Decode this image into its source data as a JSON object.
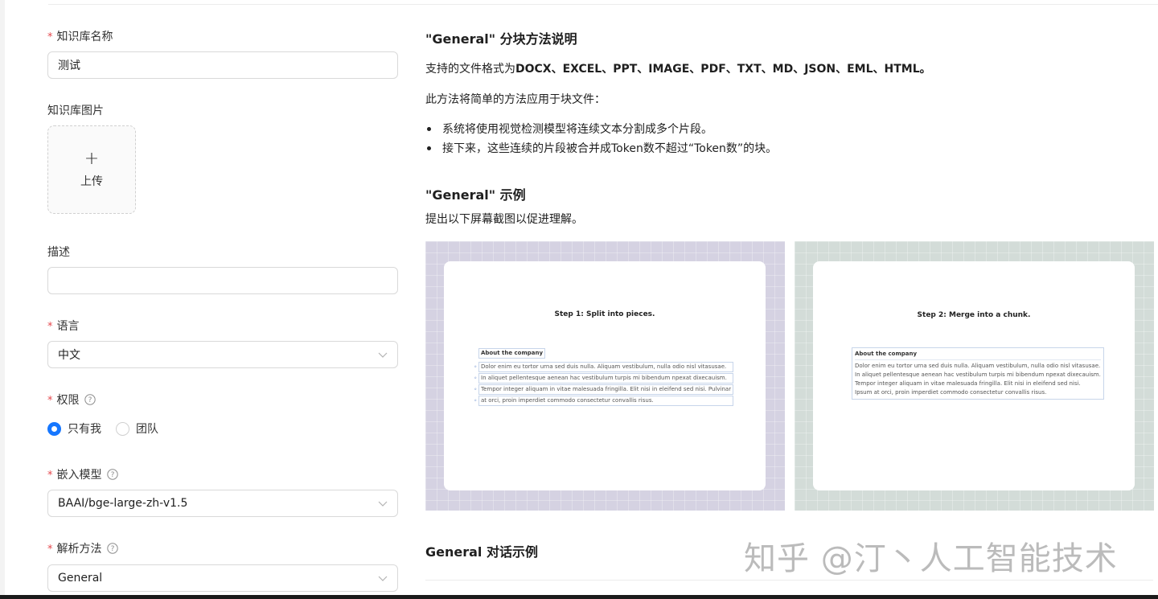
{
  "form": {
    "kb_name": {
      "label": "知识库名称",
      "required": true,
      "value": "测试"
    },
    "kb_image": {
      "label": "知识库图片",
      "upload_label": "上传"
    },
    "description": {
      "label": "描述",
      "value": ""
    },
    "language": {
      "label": "语言",
      "required": true,
      "value": "中文"
    },
    "permission": {
      "label": "权限",
      "required": true,
      "options": [
        {
          "label": "只有我",
          "selected": true
        },
        {
          "label": "团队",
          "selected": false
        }
      ]
    },
    "embedding_model": {
      "label": "嵌入模型",
      "required": true,
      "value": "BAAI/bge-large-zh-v1.5"
    },
    "parse_method": {
      "label": "解析方法",
      "required": true,
      "value": "General"
    }
  },
  "doc": {
    "method_title": "\"General\" 分块方法说明",
    "formats_prefix": "支持的文件格式为",
    "formats_list": "DOCX、EXCEL、PPT、IMAGE、PDF、TXT、MD、JSON、EML、HTML。",
    "intro": "此方法将简单的方法应用于块文件：",
    "bullets": [
      "系统将使用视觉检测模型将连续文本分割成多个片段。",
      "接下来，这些连续的片段被合并成Token数不超过“Token数”的块。"
    ],
    "example_title": "\"General\" 示例",
    "example_desc": "提出以下屏幕截图以促进理解。",
    "step1": {
      "title": "Step 1: Split into pieces.",
      "heading": "About the company",
      "lines": [
        "Dolor enim eu tortor urna sed duis nulla. Aliquam vestibulum, nulla odio nisl vitasusae.",
        "In aliquet pellentesque aenean hac vestibulum turpis mi bibendum npexat dixecauism.",
        "Tempor integer aliquam in vitae malesuada fringilla. Elit nisi in eleifend sed nisi. Pulvinar",
        "at orci, proin imperdiet commodo consectetur convallis risus."
      ]
    },
    "step2": {
      "title": "Step 2: Merge into a chunk.",
      "heading": "About the company",
      "lines": [
        "Dolor enim eu tortor urna sed duis nulla. Aliquam vestibulum, nulla odio nisl vitasusae.",
        "In aliquet pellentesque aenean hac vestibulum turpis mi bibendum npexat dixecauism.",
        "Tempor integer aliquam in vitae malesuada fringilla. Elit nisi in eleifend sed nisi.",
        "Ipsum at orci, proin imperdiet commodo consectetur convallis risus."
      ]
    },
    "chat_title": "General 对话示例"
  },
  "watermark": "知乎 @汀丶人工智能技术",
  "colors": {
    "accent": "#1677ff",
    "required": "#e5484d",
    "panel1": "#d5d2e2",
    "panel2": "#d3dcd8"
  }
}
